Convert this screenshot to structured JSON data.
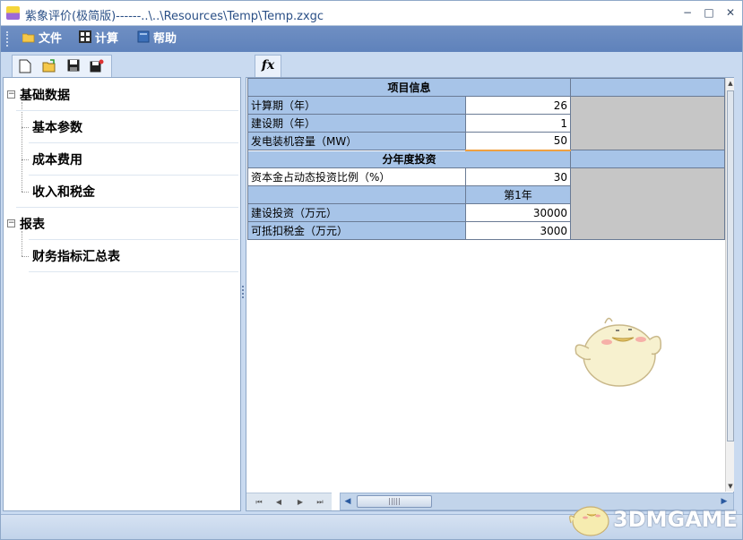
{
  "window": {
    "title": "紫象评价(极简版)------..\\..\\Resources\\Temp\\Temp.zxgc",
    "min_symbol": "−",
    "max_symbol": "□",
    "close_symbol": "✕"
  },
  "menu": {
    "file": "文件",
    "calc": "计算",
    "help": "帮助"
  },
  "toolbar": {
    "fx_label": "fx"
  },
  "tree": {
    "group1": "基础数据",
    "item1": "基本参数",
    "item2": "成本费用",
    "item3": "收入和税金",
    "group2": "报表",
    "item4": "财务指标汇总表"
  },
  "sheet": {
    "section1_title": "项目信息",
    "rows1": [
      {
        "label": "计算期（年）",
        "value": "26"
      },
      {
        "label": "建设期（年）",
        "value": "1"
      },
      {
        "label": "发电装机容量（MW）",
        "value": "50"
      }
    ],
    "section2_title": "分年度投资",
    "ratio_label": "资本金占动态投资比例（%）",
    "ratio_value": "30",
    "year_header": "第1年",
    "rows2": [
      {
        "label": "建设投资（万元）",
        "value": "30000"
      },
      {
        "label": "可抵扣税金（万元）",
        "value": "3000"
      }
    ]
  },
  "watermark": {
    "text": "3DMGAME"
  },
  "colors": {
    "menubar": "#6f8fc3",
    "header_blue": "#a7c4e8",
    "gray_cell": "#c6c6c6",
    "selection": "#f0a040"
  }
}
